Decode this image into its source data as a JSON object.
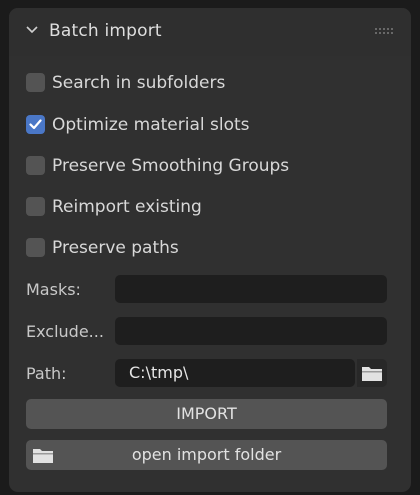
{
  "panel": {
    "title": "Batch import",
    "expand_icon": "chevron-down-icon",
    "drag_icon": "grip-dots-icon"
  },
  "options": [
    {
      "label": "Search in subfolders",
      "checked": false
    },
    {
      "label": "Optimize material slots",
      "checked": true
    },
    {
      "label": "Preserve Smoothing Groups",
      "checked": false
    },
    {
      "label": "Reimport existing",
      "checked": false
    },
    {
      "label": "Preserve paths",
      "checked": false
    }
  ],
  "fields": {
    "masks": {
      "label": "Masks:",
      "value": ""
    },
    "exclude": {
      "label": "Exclude...",
      "value": ""
    },
    "path": {
      "label": "Path:",
      "value": "C:\\tmp\\",
      "browse_icon": "folder-icon"
    }
  },
  "buttons": {
    "import": {
      "label": "IMPORT"
    },
    "open_folder": {
      "label": "open import folder",
      "icon": "folder-icon"
    }
  },
  "colors": {
    "panel_bg": "#303030",
    "field_bg": "#1e1e1e",
    "button_bg": "#545454",
    "checkbox_checked": "#4a77c7"
  }
}
